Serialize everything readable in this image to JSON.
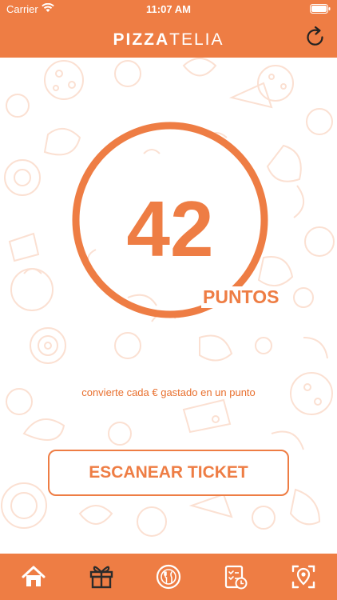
{
  "status_bar": {
    "carrier": "Carrier",
    "time": "11:07 AM"
  },
  "header": {
    "brand_bold": "PIZZA",
    "brand_light": "TELIA",
    "refresh_icon": "refresh-icon"
  },
  "points": {
    "value": "42",
    "unit": "PUNTOS",
    "caption": "convierte cada € gastado en un punto"
  },
  "actions": {
    "scan_label": "ESCANEAR TICKET"
  },
  "tabbar": {
    "items": [
      {
        "icon": "home-icon",
        "active": true
      },
      {
        "icon": "gift-icon",
        "active": false
      },
      {
        "icon": "plate-cutlery-icon",
        "active": false
      },
      {
        "icon": "checklist-clock-icon",
        "active": false
      },
      {
        "icon": "location-scan-icon",
        "active": false
      }
    ]
  },
  "colors": {
    "brand": "#ee7d44",
    "doodle": "#fbe3d6",
    "background": "#ffffff",
    "active_icon": "#ffffff",
    "dark_icon": "#2b2b2b"
  }
}
